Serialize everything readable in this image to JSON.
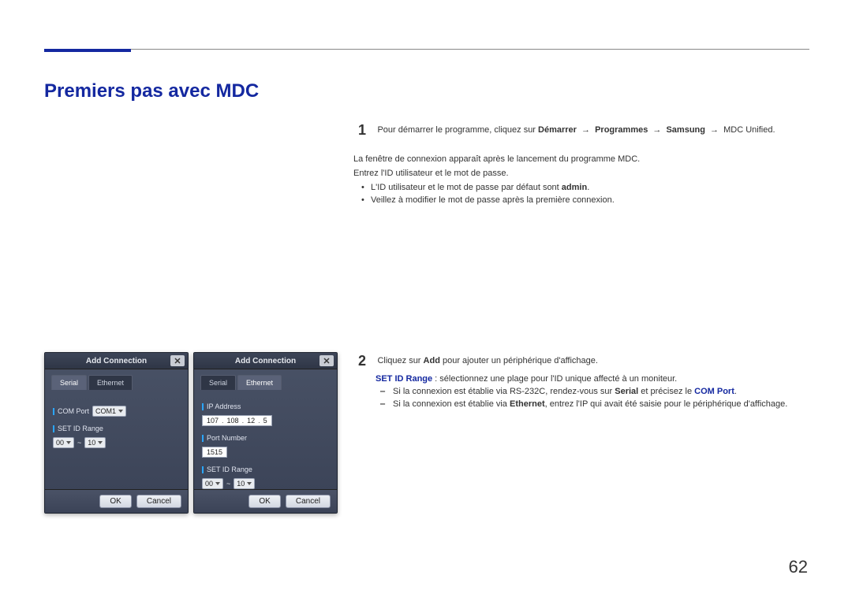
{
  "heading": "Premiers pas avec MDC",
  "page_number": "62",
  "steps": {
    "s1": {
      "num": "1",
      "lead": "Pour démarrer le programme, cliquez sur ",
      "path": [
        "Démarrer",
        "Programmes",
        "Samsung",
        "MDC Unified"
      ],
      "arrow": "→",
      "after": "La fenêtre de connexion apparaît après le lancement du programme MDC.",
      "enter": "Entrez l'ID utilisateur et le mot de passe.",
      "bullets": [
        {
          "pre": "L'ID utilisateur et le mot de passe par défaut sont ",
          "bold": "admin",
          "post": "."
        },
        {
          "pre": "Veillez à modifier le mot de passe après la première connexion.",
          "bold": "",
          "post": ""
        }
      ]
    },
    "s2": {
      "num": "2",
      "lead_pre": "Cliquez sur ",
      "lead_bold": "Add",
      "lead_post": " pour ajouter un périphérique d'affichage.",
      "range_label": "SET ID Range",
      "range_rest": " : sélectionnez une plage pour l'ID unique affecté à un moniteur.",
      "dash1_pre": "Si la connexion est établie via RS-232C, rendez-vous sur ",
      "dash1_b1": "Serial",
      "dash1_mid": " et précisez le ",
      "dash1_col": "COM Port",
      "dash1_post": ".",
      "dash2_pre": "Si la connexion est établie via ",
      "dash2_b1": "Ethernet",
      "dash2_post": ", entrez l'IP qui avait été saisie pour le périphérique d'affichage."
    }
  },
  "dialog": {
    "title": "Add Connection",
    "tabs": {
      "serial": "Serial",
      "ethernet": "Ethernet"
    },
    "labels": {
      "com_port": "COM Port",
      "com_value": "COM1",
      "set_id_range": "SET ID Range",
      "ip_address": "IP Address",
      "port_number": "Port Number",
      "port_value": "1515"
    },
    "range": {
      "from": "00",
      "tilde": "~",
      "to": "10"
    },
    "ip": [
      "107",
      "108",
      "12",
      "5"
    ],
    "buttons": {
      "ok": "OK",
      "cancel": "Cancel"
    }
  }
}
